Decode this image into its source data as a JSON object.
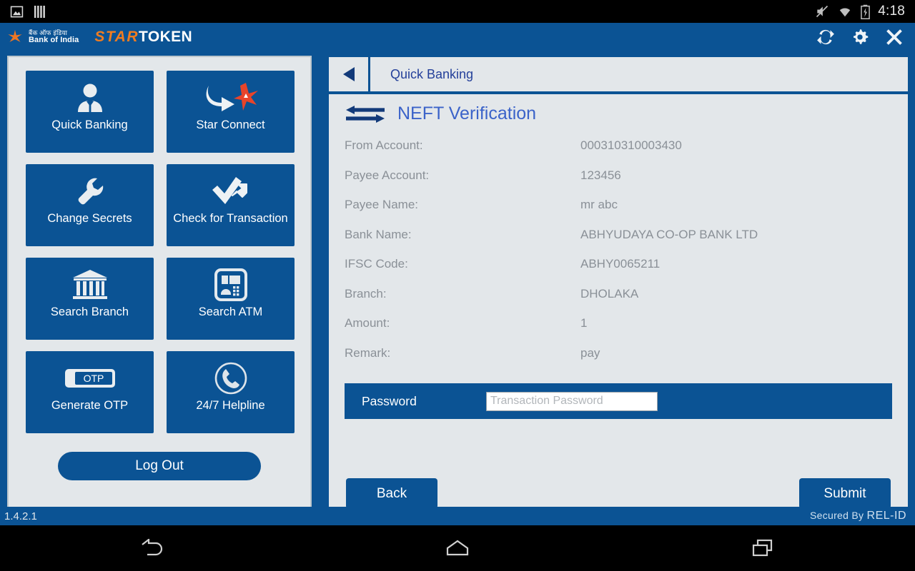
{
  "status_bar": {
    "icons": [
      "image-icon",
      "sim-bars-icon",
      "mute-icon",
      "wifi-icon",
      "battery-charging-icon"
    ],
    "clock": "4:18"
  },
  "app_header": {
    "bank_hindi": "बैंक ऑफ इंडिया",
    "bank_english": "Bank of India",
    "logo_star": "STAR",
    "logo_token": "TOKEN",
    "actions": [
      {
        "name": "sync-icon",
        "label": "Sync"
      },
      {
        "name": "gear-icon",
        "label": "Settings"
      },
      {
        "name": "close-icon",
        "label": "Close"
      }
    ]
  },
  "sidebar": {
    "tiles": [
      {
        "label": "Quick Banking",
        "icon": "user-icon"
      },
      {
        "label": "Star Connect",
        "icon": "arrow-star-icon"
      },
      {
        "label": "Change Secrets",
        "icon": "wrench-icon"
      },
      {
        "label": "Check for Transaction",
        "icon": "checkmark-arrow-icon"
      },
      {
        "label": "Search Branch",
        "icon": "bank-building-icon"
      },
      {
        "label": "Search ATM",
        "icon": "atm-machine-icon"
      },
      {
        "label": "Generate OTP",
        "icon": "otp-token-icon"
      },
      {
        "label": "24/7 Helpline",
        "icon": "phone-icon"
      }
    ],
    "logout_label": "Log Out"
  },
  "content": {
    "back_arrow": "back-triangle-icon",
    "breadcrumb": "Quick Banking",
    "title_icon": "transfer-arrows-icon",
    "title": "NEFT Verification",
    "fields": [
      {
        "label": "From Account:",
        "value": "000310310003430"
      },
      {
        "label": "Payee Account:",
        "value": "123456"
      },
      {
        "label": "Payee Name:",
        "value": "mr abc"
      },
      {
        "label": "Bank Name:",
        "value": "ABHYUDAYA CO-OP BANK LTD"
      },
      {
        "label": "IFSC Code:",
        "value": "ABHY0065211"
      },
      {
        "label": "Branch:",
        "value": "DHOLAKA"
      },
      {
        "label": "Amount:",
        "value": "1"
      },
      {
        "label": "Remark:",
        "value": "pay"
      }
    ],
    "password": {
      "label": "Password",
      "value": "",
      "placeholder": "Transaction Password"
    },
    "back_button": "Back",
    "submit_button": "Submit"
  },
  "footer": {
    "version": "1.4.2.1",
    "secured_prefix": "Secured By",
    "secured_brand": "REL-ID"
  },
  "nav_bar": {
    "buttons": [
      {
        "name": "android-back-icon"
      },
      {
        "name": "android-home-icon"
      },
      {
        "name": "android-recents-icon"
      }
    ]
  },
  "colors": {
    "brand_blue": "#0b5394",
    "panel_bg": "#e3e7ea",
    "accent_orange": "#f07c20",
    "title_blue": "#3b63c9",
    "label_gray": "#8a9097"
  }
}
